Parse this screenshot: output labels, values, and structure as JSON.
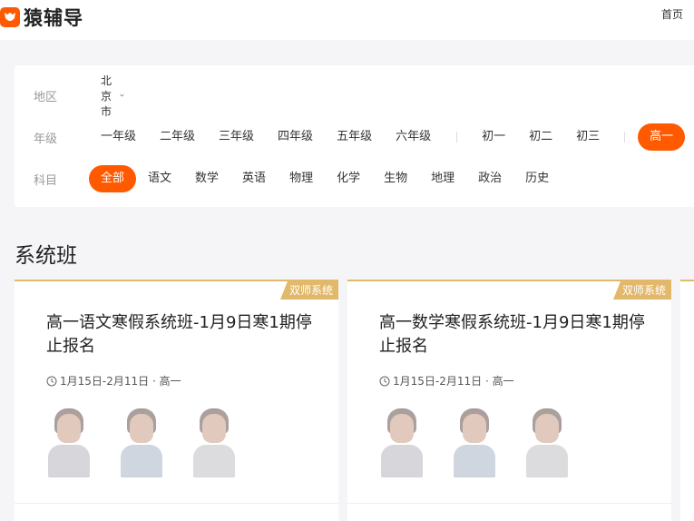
{
  "header": {
    "brand": "猿辅导",
    "home_link": "首页"
  },
  "filters": {
    "region": {
      "label": "地区",
      "selected": "北京市"
    },
    "grade": {
      "label": "年级",
      "primary": [
        "一年级",
        "二年级",
        "三年级",
        "四年级",
        "五年级",
        "六年级"
      ],
      "junior": [
        "初一",
        "初二",
        "初三"
      ],
      "senior_active": "高一"
    },
    "subject": {
      "label": "科目",
      "active": "全部",
      "items": [
        "语文",
        "数学",
        "英语",
        "物理",
        "化学",
        "生物",
        "地理",
        "政治",
        "历史"
      ]
    }
  },
  "section": {
    "title": "系统班"
  },
  "cards": [
    {
      "tag": "双师系统",
      "title": "高一语文寒假系统班-1月9日寒1期停止报名",
      "meta": "1月15日-2月11日 · 高一"
    },
    {
      "tag": "双师系统",
      "title": "高一数学寒假系统班-1月9日寒1期停止报名",
      "meta": "1月15日-2月11日 · 高一"
    }
  ],
  "colors": {
    "accent": "#ff5a00",
    "tag_gold": "#e2b86a"
  }
}
